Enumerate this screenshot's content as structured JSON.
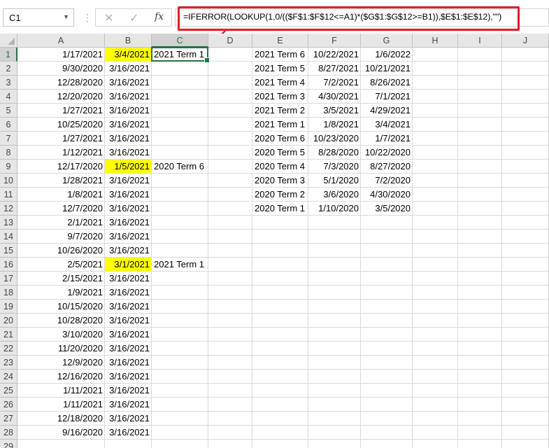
{
  "formula_bar": {
    "name_box": "C1",
    "cancel_icon": "✕",
    "enter_icon": "✓",
    "fx_label": "fx",
    "formula": "=IFERROR(LOOKUP(1,0/(($F$1:$F$12<=A1)*($G$1:$G$12>=B1)),$E$1:$E$12),\"\")"
  },
  "columns": [
    "A",
    "B",
    "C",
    "D",
    "E",
    "F",
    "G",
    "H",
    "I",
    "J"
  ],
  "active_cell": "C1",
  "highlight_color": "#ffff00",
  "rows": [
    {
      "A": "1/17/2021",
      "B": "3/4/2021",
      "C": "2021 Term 1",
      "E": "2021 Term 6",
      "F": "10/22/2021",
      "G": "1/6/2022",
      "hl": true
    },
    {
      "A": "9/30/2020",
      "B": "3/16/2021",
      "C": "",
      "E": "2021 Term 5",
      "F": "8/27/2021",
      "G": "10/21/2021"
    },
    {
      "A": "12/28/2020",
      "B": "3/16/2021",
      "C": "",
      "E": "2021 Term 4",
      "F": "7/2/2021",
      "G": "8/26/2021"
    },
    {
      "A": "12/20/2020",
      "B": "3/16/2021",
      "C": "",
      "E": "2021 Term 3",
      "F": "4/30/2021",
      "G": "7/1/2021"
    },
    {
      "A": "1/27/2021",
      "B": "3/16/2021",
      "C": "",
      "E": "2021 Term 2",
      "F": "3/5/2021",
      "G": "4/29/2021"
    },
    {
      "A": "10/25/2020",
      "B": "3/16/2021",
      "C": "",
      "E": "2021 Term 1",
      "F": "1/8/2021",
      "G": "3/4/2021"
    },
    {
      "A": "1/27/2021",
      "B": "3/16/2021",
      "C": "",
      "E": "2020 Term 6",
      "F": "10/23/2020",
      "G": "1/7/2021"
    },
    {
      "A": "1/12/2021",
      "B": "3/16/2021",
      "C": "",
      "E": "2020 Term 5",
      "F": "8/28/2020",
      "G": "10/22/2020"
    },
    {
      "A": "12/17/2020",
      "B": "1/5/2021",
      "C": "2020 Term 6",
      "E": "2020 Term 4",
      "F": "7/3/2020",
      "G": "8/27/2020",
      "hl": true
    },
    {
      "A": "1/28/2021",
      "B": "3/16/2021",
      "C": "",
      "E": "2020 Term 3",
      "F": "5/1/2020",
      "G": "7/2/2020"
    },
    {
      "A": "1/8/2021",
      "B": "3/16/2021",
      "C": "",
      "E": "2020 Term 2",
      "F": "3/6/2020",
      "G": "4/30/2020"
    },
    {
      "A": "12/7/2020",
      "B": "3/16/2021",
      "C": "",
      "E": "2020 Term 1",
      "F": "1/10/2020",
      "G": "3/5/2020"
    },
    {
      "A": "2/1/2021",
      "B": "3/16/2021",
      "C": ""
    },
    {
      "A": "9/7/2020",
      "B": "3/16/2021",
      "C": ""
    },
    {
      "A": "10/26/2020",
      "B": "3/16/2021",
      "C": ""
    },
    {
      "A": "2/5/2021",
      "B": "3/1/2021",
      "C": "2021 Term 1",
      "hl": true
    },
    {
      "A": "2/15/2021",
      "B": "3/16/2021",
      "C": ""
    },
    {
      "A": "1/9/2021",
      "B": "3/16/2021",
      "C": ""
    },
    {
      "A": "10/15/2020",
      "B": "3/16/2021",
      "C": ""
    },
    {
      "A": "10/28/2020",
      "B": "3/16/2021",
      "C": ""
    },
    {
      "A": "3/10/2020",
      "B": "3/16/2021",
      "C": ""
    },
    {
      "A": "11/20/2020",
      "B": "3/16/2021",
      "C": ""
    },
    {
      "A": "12/9/2020",
      "B": "3/16/2021",
      "C": ""
    },
    {
      "A": "12/16/2020",
      "B": "3/16/2021",
      "C": ""
    },
    {
      "A": "1/11/2021",
      "B": "3/16/2021",
      "C": ""
    },
    {
      "A": "1/11/2021",
      "B": "3/16/2021",
      "C": ""
    },
    {
      "A": "12/18/2020",
      "B": "3/16/2021",
      "C": ""
    },
    {
      "A": "9/16/2020",
      "B": "3/16/2021",
      "C": ""
    },
    {}
  ]
}
